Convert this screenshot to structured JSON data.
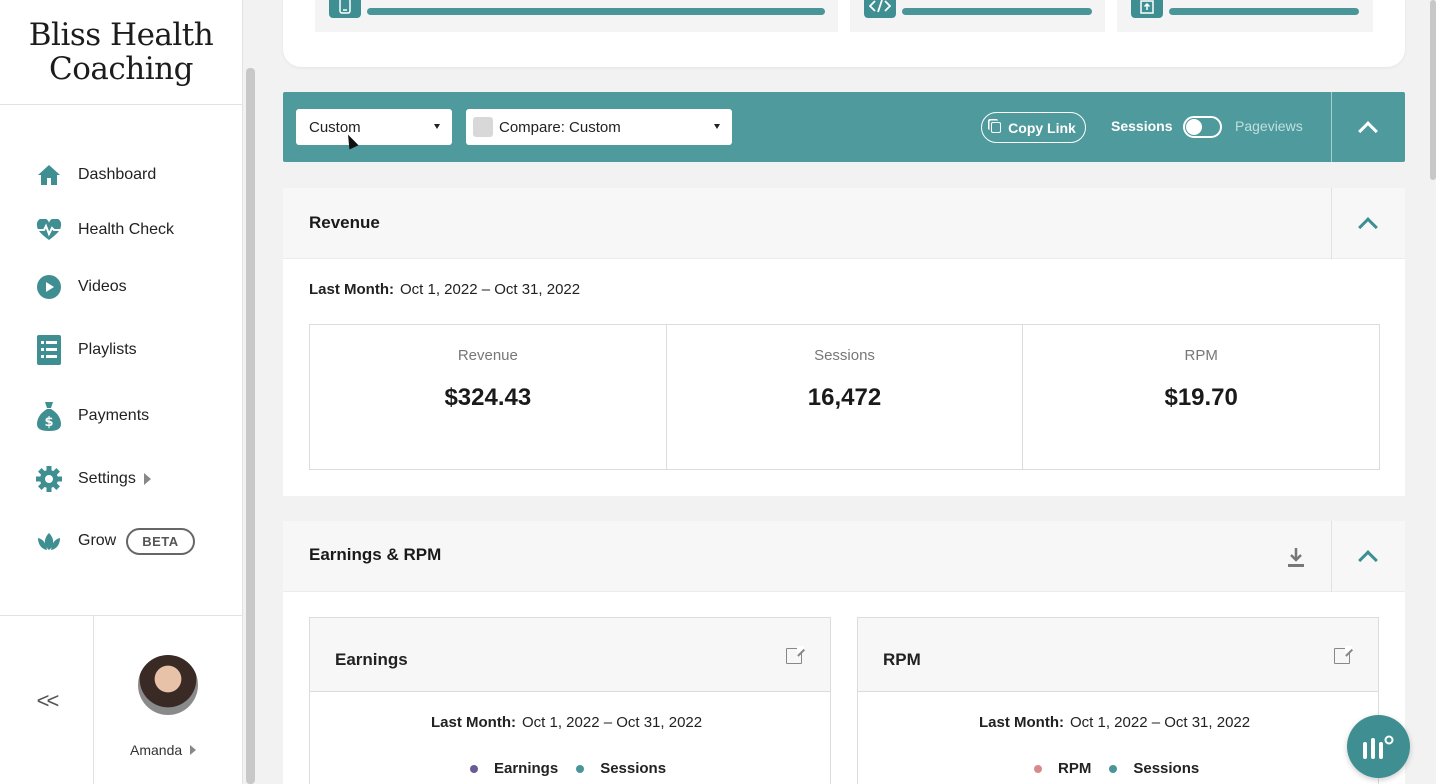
{
  "brand": {
    "line1": "Bliss Health",
    "line2": "Coaching"
  },
  "nav": [
    {
      "label": "Dashboard",
      "icon": "home-icon"
    },
    {
      "label": "Health Check",
      "icon": "heartbeat-icon"
    },
    {
      "label": "Videos",
      "icon": "play-icon"
    },
    {
      "label": "Playlists",
      "icon": "list-icon"
    },
    {
      "label": "Payments",
      "icon": "money-bag-icon"
    },
    {
      "label": "Settings",
      "icon": "gear-icon"
    },
    {
      "label": "Grow",
      "icon": "leaf-icon",
      "badge": "BETA"
    }
  ],
  "sidebar_footer": {
    "collapse_label": "<<",
    "user_name": "Amanda"
  },
  "filters": {
    "range_select": "Custom",
    "compare_select": "Compare: Custom",
    "copy_link": "Copy Link",
    "toggle_left": "Sessions",
    "toggle_right": "Pageviews"
  },
  "revenue_panel": {
    "title": "Revenue",
    "range_label": "Last Month:",
    "range_value": "Oct 1, 2022 – Oct 31, 2022",
    "stats": [
      {
        "label": "Revenue",
        "value": "$324.43"
      },
      {
        "label": "Sessions",
        "value": "16,472"
      },
      {
        "label": "RPM",
        "value": "$19.70"
      }
    ]
  },
  "earnings_panel": {
    "title": "Earnings & RPM",
    "cards": [
      {
        "title": "Earnings",
        "range_label": "Last Month:",
        "range_value": "Oct 1, 2022 – Oct 31, 2022",
        "legend": [
          {
            "label": "Earnings",
            "color": "#6b5b95"
          },
          {
            "label": "Sessions",
            "color": "#4a9598"
          }
        ]
      },
      {
        "title": "RPM",
        "range_label": "Last Month:",
        "range_value": "Oct 1, 2022 – Oct 31, 2022",
        "legend": [
          {
            "label": "RPM",
            "color": "#d88a8a"
          },
          {
            "label": "Sessions",
            "color": "#4a9598"
          }
        ]
      }
    ]
  },
  "colors": {
    "accent": "#4f9a9d",
    "accent_dark": "#3f8f92"
  }
}
